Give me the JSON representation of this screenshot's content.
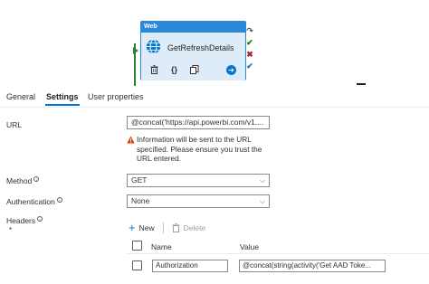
{
  "activity": {
    "type_label": "Web",
    "name": "GetRefreshDetails"
  },
  "tabs": [
    {
      "label": "General"
    },
    {
      "label": "Settings"
    },
    {
      "label": "User properties"
    }
  ],
  "form": {
    "url": {
      "label": "URL",
      "value": "@concat('https://api.powerbi.com/v1....",
      "warning": "Information will be sent to the URL specified. Please ensure you trust the URL entered."
    },
    "method": {
      "label": "Method",
      "required_mark": "*",
      "value": "GET"
    },
    "authentication": {
      "label": "Authentication",
      "value": "None"
    },
    "headers": {
      "label": "Headers",
      "required_mark": "*",
      "new_label": "New",
      "delete_label": "Delete",
      "columns": [
        "Name",
        "Value"
      ],
      "rows": [
        {
          "name": "Authorization",
          "value": "@concat(string(activity('Get AAD Toke..."
        }
      ]
    }
  },
  "colors": {
    "accent": "#0078d4",
    "activity_header": "#2b88d8",
    "activity_body": "#deecf9",
    "success": "#107c10",
    "error": "#a4262c",
    "warning": "#d83b01"
  }
}
